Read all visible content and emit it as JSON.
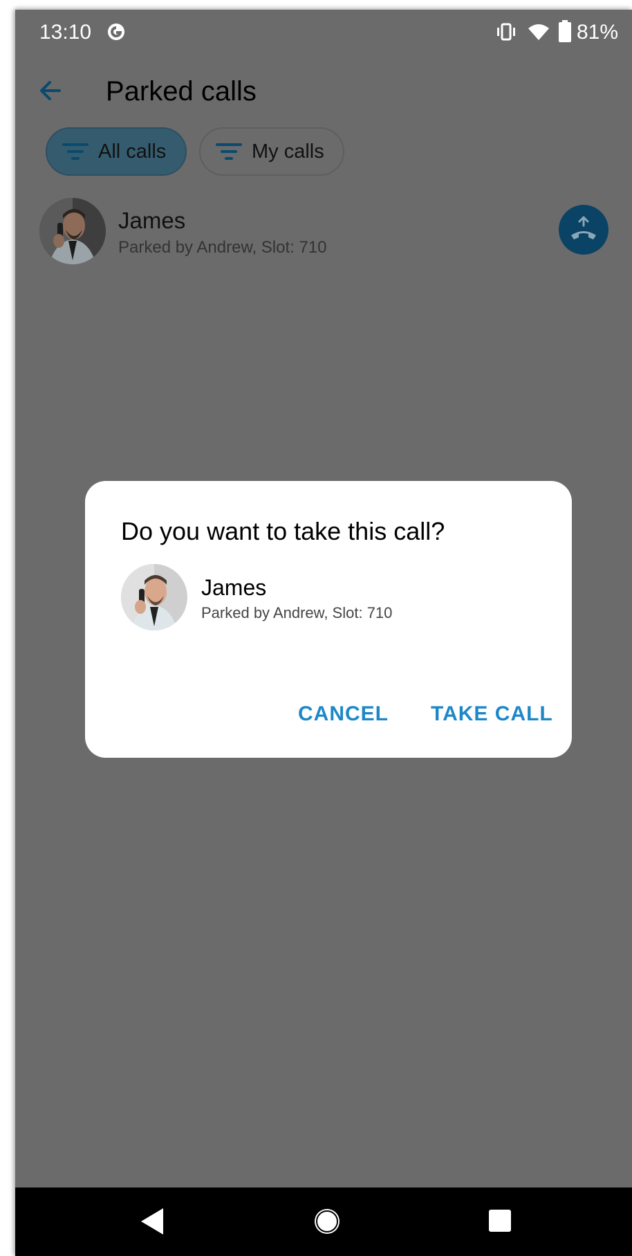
{
  "status_bar": {
    "time": "13:10",
    "battery": "81%",
    "icons": [
      "g-icon",
      "vibrate-icon",
      "wifi-icon",
      "battery-icon"
    ]
  },
  "header": {
    "title": "Parked calls",
    "back_icon": "arrow-left-icon"
  },
  "filters": [
    {
      "label": "All calls",
      "icon": "filter-icon",
      "selected": true
    },
    {
      "label": "My calls",
      "icon": "filter-icon",
      "selected": false
    }
  ],
  "parked_calls": [
    {
      "name": "James",
      "detail": "Parked by Andrew, Slot: 710",
      "action_icon": "take-call-icon"
    }
  ],
  "dialog": {
    "title": "Do you want to take this call?",
    "name": "James",
    "detail": "Parked by Andrew, Slot: 710",
    "cancel_label": "CANCEL",
    "confirm_label": "TAKE CALL"
  },
  "nav": {
    "icons": [
      "back-triangle-icon",
      "home-circle-icon",
      "recents-square-icon"
    ]
  },
  "colors": {
    "scrim": "#6b6b6b",
    "accent": "#1e88c7",
    "chip_selected": "#355c6e",
    "take_button": "#0a4365"
  }
}
